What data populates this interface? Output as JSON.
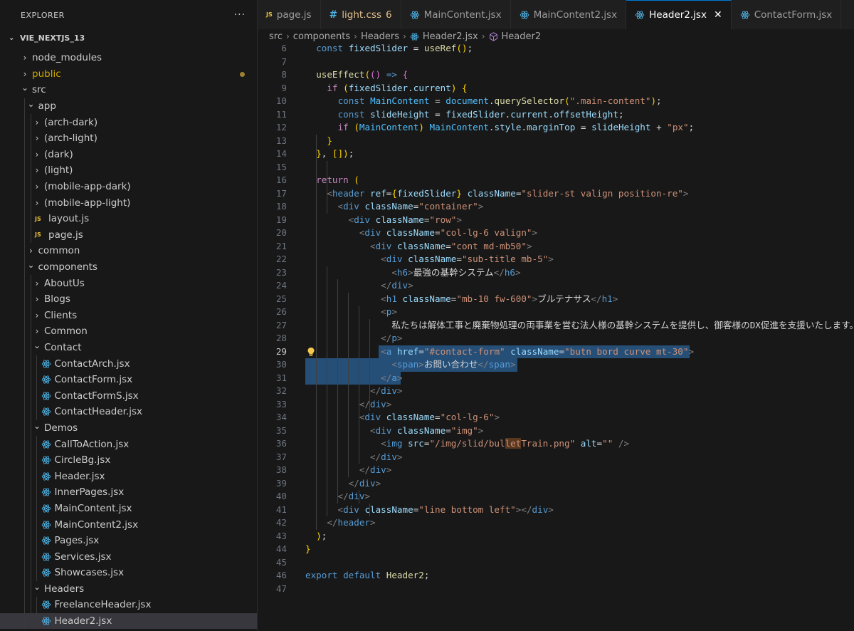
{
  "explorer": {
    "title": "EXPLORER",
    "more": "···",
    "root_name": "VIE_NEXTJS_13",
    "items": [
      {
        "label": "node_modules",
        "depth": 0,
        "type": "folder",
        "expanded": false
      },
      {
        "label": "public",
        "depth": 0,
        "type": "folder",
        "expanded": false,
        "modified": true
      },
      {
        "label": "src",
        "depth": 0,
        "type": "folder",
        "expanded": true
      },
      {
        "label": "app",
        "depth": 1,
        "type": "folder",
        "expanded": true
      },
      {
        "label": "(arch-dark)",
        "depth": 2,
        "type": "folder",
        "expanded": false
      },
      {
        "label": "(arch-light)",
        "depth": 2,
        "type": "folder",
        "expanded": false
      },
      {
        "label": "(dark)",
        "depth": 2,
        "type": "folder",
        "expanded": false
      },
      {
        "label": "(light)",
        "depth": 2,
        "type": "folder",
        "expanded": false
      },
      {
        "label": "(mobile-app-dark)",
        "depth": 2,
        "type": "folder",
        "expanded": false
      },
      {
        "label": "(mobile-app-light)",
        "depth": 2,
        "type": "folder",
        "expanded": false
      },
      {
        "label": "layout.js",
        "depth": 2,
        "type": "js"
      },
      {
        "label": "page.js",
        "depth": 2,
        "type": "js"
      },
      {
        "label": "common",
        "depth": 1,
        "type": "folder",
        "expanded": false
      },
      {
        "label": "components",
        "depth": 1,
        "type": "folder",
        "expanded": true
      },
      {
        "label": "AboutUs",
        "depth": 2,
        "type": "folder",
        "expanded": false
      },
      {
        "label": "Blogs",
        "depth": 2,
        "type": "folder",
        "expanded": false
      },
      {
        "label": "Clients",
        "depth": 2,
        "type": "folder",
        "expanded": false
      },
      {
        "label": "Common",
        "depth": 2,
        "type": "folder",
        "expanded": false
      },
      {
        "label": "Contact",
        "depth": 2,
        "type": "folder",
        "expanded": true
      },
      {
        "label": "ContactArch.jsx",
        "depth": 3,
        "type": "jsx"
      },
      {
        "label": "ContactForm.jsx",
        "depth": 3,
        "type": "jsx"
      },
      {
        "label": "ContactFormS.jsx",
        "depth": 3,
        "type": "jsx"
      },
      {
        "label": "ContactHeader.jsx",
        "depth": 3,
        "type": "jsx"
      },
      {
        "label": "Demos",
        "depth": 2,
        "type": "folder",
        "expanded": true
      },
      {
        "label": "CallToAction.jsx",
        "depth": 3,
        "type": "jsx"
      },
      {
        "label": "CircleBg.jsx",
        "depth": 3,
        "type": "jsx"
      },
      {
        "label": "Header.jsx",
        "depth": 3,
        "type": "jsx"
      },
      {
        "label": "InnerPages.jsx",
        "depth": 3,
        "type": "jsx"
      },
      {
        "label": "MainContent.jsx",
        "depth": 3,
        "type": "jsx"
      },
      {
        "label": "MainContent2.jsx",
        "depth": 3,
        "type": "jsx"
      },
      {
        "label": "Pages.jsx",
        "depth": 3,
        "type": "jsx"
      },
      {
        "label": "Services.jsx",
        "depth": 3,
        "type": "jsx"
      },
      {
        "label": "Showcases.jsx",
        "depth": 3,
        "type": "jsx"
      },
      {
        "label": "Headers",
        "depth": 2,
        "type": "folder",
        "expanded": true
      },
      {
        "label": "FreelanceHeader.jsx",
        "depth": 3,
        "type": "jsx"
      },
      {
        "label": "Header2.jsx",
        "depth": 3,
        "type": "jsx",
        "selected": true
      }
    ]
  },
  "tabs": [
    {
      "label": "page.js",
      "kind": "js"
    },
    {
      "label": "light.css",
      "kind": "css",
      "count": "6"
    },
    {
      "label": "MainContent.jsx",
      "kind": "jsx"
    },
    {
      "label": "MainContent2.jsx",
      "kind": "jsx"
    },
    {
      "label": "Header2.jsx",
      "kind": "jsx",
      "active": true,
      "close": "✕"
    },
    {
      "label": "ContactForm.jsx",
      "kind": "jsx"
    }
  ],
  "breadcrumb": [
    "src",
    "components",
    "Headers",
    "Header2.jsx",
    "Header2"
  ],
  "editor": {
    "first_line": 6,
    "active_line": 29,
    "lines": [
      "  const fixedSlider = useRef();",
      "",
      "  useEffect(() => {",
      "    if (fixedSlider.current) {",
      "      const MainContent = document.querySelector(\".main-content\");",
      "      const slideHeight = fixedSlider.current.offsetHeight;",
      "      if (MainContent) MainContent.style.marginTop = slideHeight + \"px\";",
      "    }",
      "  }, []);",
      "",
      "  return (",
      "    <header ref={fixedSlider} className=\"slider-st valign position-re\">",
      "      <div className=\"container\">",
      "        <div className=\"row\">",
      "          <div className=\"col-lg-6 valign\">",
      "            <div className=\"cont md-mb50\">",
      "              <div className=\"sub-title mb-5\">",
      "                <h6>最強の基幹システム</h6>",
      "              </div>",
      "              <h1 className=\"mb-10 fw-600\">ブルテナサス</h1>",
      "              <p>",
      "                私たちは解体工事と廃棄物処理の両事業を営む法人様の基幹システムを提供し、御客様のDX促進を支援いたします。",
      "              </p>",
      "              <a href=\"#contact-form\" className=\"butn bord curve mt-30\">",
      "                <span>お問い合わせ</span>",
      "              </a>",
      "            </div>",
      "          </div>",
      "          <div className=\"col-lg-6\">",
      "            <div className=\"img\">",
      "              <img src=\"/img/slid/bulletTrain.png\" alt=\"\" />",
      "            </div>",
      "          </div>",
      "        </div>",
      "      </div>",
      "      <div className=\"line bottom left\"></div>",
      "    </header>",
      "  );",
      "}",
      "",
      "export default Header2;",
      ""
    ]
  },
  "colors": {
    "accent": "#0078d4",
    "selection": "#264f78",
    "modified_dot": "#9e7f33",
    "js_badge": "#e8c13a",
    "react_icon": "#4fb3e6"
  }
}
